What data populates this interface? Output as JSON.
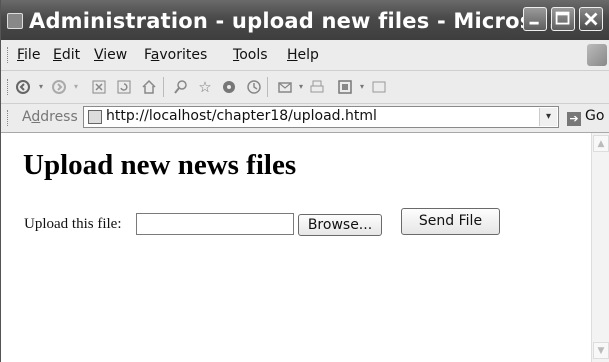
{
  "window": {
    "title": "Administration - upload new files - Micros..."
  },
  "menubar": {
    "items": [
      {
        "accel": "F",
        "rest": "ile"
      },
      {
        "accel": "E",
        "rest": "dit"
      },
      {
        "accel": "V",
        "rest": "iew"
      },
      {
        "pre": "F",
        "accel": "a",
        "rest": "vorites"
      },
      {
        "accel": "T",
        "rest": "ools"
      },
      {
        "accel": "H",
        "rest": "elp"
      }
    ]
  },
  "toolbar": {
    "icons": [
      "back-icon",
      "forward-icon",
      "stop-icon",
      "refresh-icon",
      "home-icon",
      "search-icon",
      "favorites-icon",
      "media-icon",
      "history-icon",
      "mail-icon",
      "print-icon",
      "edit-icon",
      "discuss-icon"
    ]
  },
  "address": {
    "label_pre": "A",
    "label_accel": "d",
    "label_rest": "dress",
    "url": "http://localhost/chapter18/upload.html",
    "go_label": "Go"
  },
  "page": {
    "heading": "Upload new news files",
    "upload_label": "Upload this file:",
    "file_value": "",
    "browse_label": "Browse...",
    "send_label": "Send File"
  }
}
